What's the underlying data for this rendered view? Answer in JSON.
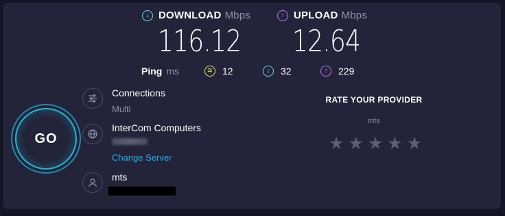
{
  "download": {
    "label": "DOWNLOAD",
    "unit": "Mbps",
    "value": "116.12"
  },
  "upload": {
    "label": "UPLOAD",
    "unit": "Mbps",
    "value": "12.64"
  },
  "ping": {
    "label": "Ping",
    "unit": "ms",
    "jitter": "12",
    "download": "32",
    "upload": "229"
  },
  "go_label": "GO",
  "connections": {
    "title": "Connections",
    "value": "Multi"
  },
  "server": {
    "name": "InterCom Computers",
    "change_label": "Change Server"
  },
  "provider": {
    "name": "mts"
  },
  "rating": {
    "title": "RATE YOUR PROVIDER",
    "provider": "mts",
    "stars": 5
  },
  "colors": {
    "download": "#6fd6ef",
    "upload": "#bf71ff",
    "jitter": "#e5e36b",
    "link": "#1fb0e6",
    "go_ring": "#21b8d3"
  }
}
